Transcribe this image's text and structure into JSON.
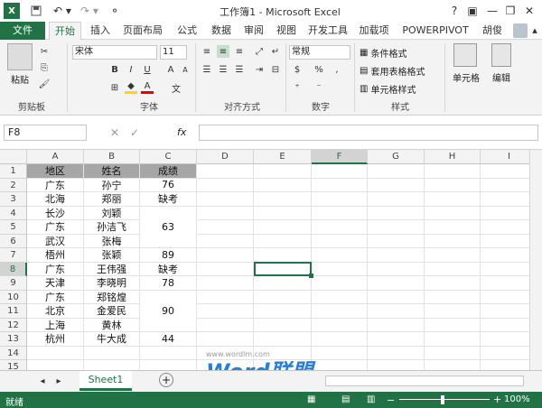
{
  "app": {
    "title": "工作簿1 - Microsoft Excel",
    "user": "胡俊"
  },
  "qat": {
    "help": "?"
  },
  "tabs": [
    {
      "label": "文件"
    },
    {
      "label": "开始"
    },
    {
      "label": "插入"
    },
    {
      "label": "页面布局"
    },
    {
      "label": "公式"
    },
    {
      "label": "数据"
    },
    {
      "label": "审阅"
    },
    {
      "label": "视图"
    },
    {
      "label": "开发工具"
    },
    {
      "label": "加载项"
    },
    {
      "label": "POWERPIVOT"
    }
  ],
  "ribbon": {
    "paste": "粘贴",
    "font_name": "宋体",
    "font_size": "11",
    "number_format": "常规",
    "cond_format": "条件格式",
    "table_format": "套用表格格式",
    "cell_style": "单元格样式",
    "cells": "单元格",
    "edit": "编辑",
    "groups": {
      "clipboard": "剪贴板",
      "font": "字体",
      "align": "对齐方式",
      "number": "数字",
      "styles": "样式"
    },
    "bold": "B",
    "italic": "I",
    "underline": "U",
    "grow": "A",
    "shrink": "A"
  },
  "formula": {
    "namebox": "F8",
    "fx": "fx",
    "value": ""
  },
  "columns": [
    "A",
    "B",
    "C",
    "D",
    "E",
    "F",
    "G",
    "H",
    "I",
    "J"
  ],
  "rows": [
    "1",
    "2",
    "3",
    "4",
    "5",
    "6",
    "7",
    "8",
    "9",
    "10",
    "11",
    "12",
    "13",
    "14",
    "15",
    "16"
  ],
  "cells": {
    "header": {
      "region": "地区",
      "name": "姓名",
      "score": "成绩"
    },
    "region": [
      "广东",
      "北海",
      "长沙",
      "广东",
      "武汉",
      "梧州",
      "广东",
      "天津",
      "广东",
      "北京",
      "上海",
      "杭州"
    ],
    "name": [
      "孙宁",
      "郑丽",
      "刘颖",
      "孙洁飞",
      "张梅",
      "张颖",
      "王伟强",
      "李晓明",
      "郑铭煌",
      "金爱民",
      "黄林",
      "牛大成"
    ],
    "score_cells": [
      "76",
      "缺考",
      "63",
      "89",
      "缺考",
      "78",
      "90",
      "44"
    ]
  },
  "sheet": {
    "tab": "Sheet1",
    "add": "+"
  },
  "watermark": {
    "text": "Word联盟",
    "url": "www.wordlm.com"
  },
  "status": {
    "ready": "就绪",
    "zoom": "100%"
  },
  "colors": {
    "brand": "#217346",
    "header_fill": "#a6a6a6",
    "selection": "#217346"
  }
}
